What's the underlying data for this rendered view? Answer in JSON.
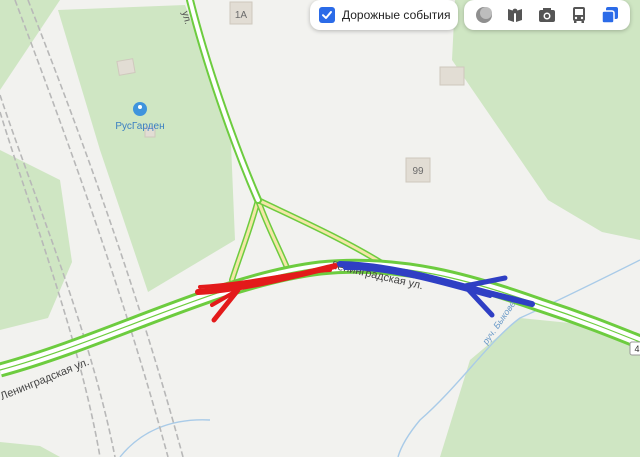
{
  "map": {
    "labels": {
      "building_1a": "1А",
      "building_99": "99",
      "poi_name": "РусГарден",
      "street_top": "ул.",
      "street_left": "Ленинградская ул.",
      "street_center": "Ленинградская ул.",
      "stream": "руч. Быковец",
      "route_badge": "4"
    },
    "colors": {
      "background": "#f2f2ef",
      "park": "#cfe6c3",
      "road_traffic": "#6dcc3f",
      "road_fill": "#ffffff",
      "ramp": "#f3e7a6",
      "rail": "#b8b8b8",
      "water": "#a9cbe8",
      "poi_icon": "#3f94dd",
      "annotation_red": "#e31a1a",
      "annotation_blue": "#2f3fc4"
    }
  },
  "layers": {
    "events_label": "Дорожные события",
    "events_checked": true,
    "tools": [
      "layers-icon",
      "panorama-icon",
      "photo-icon",
      "transit-icon",
      "map-layers-icon"
    ]
  }
}
